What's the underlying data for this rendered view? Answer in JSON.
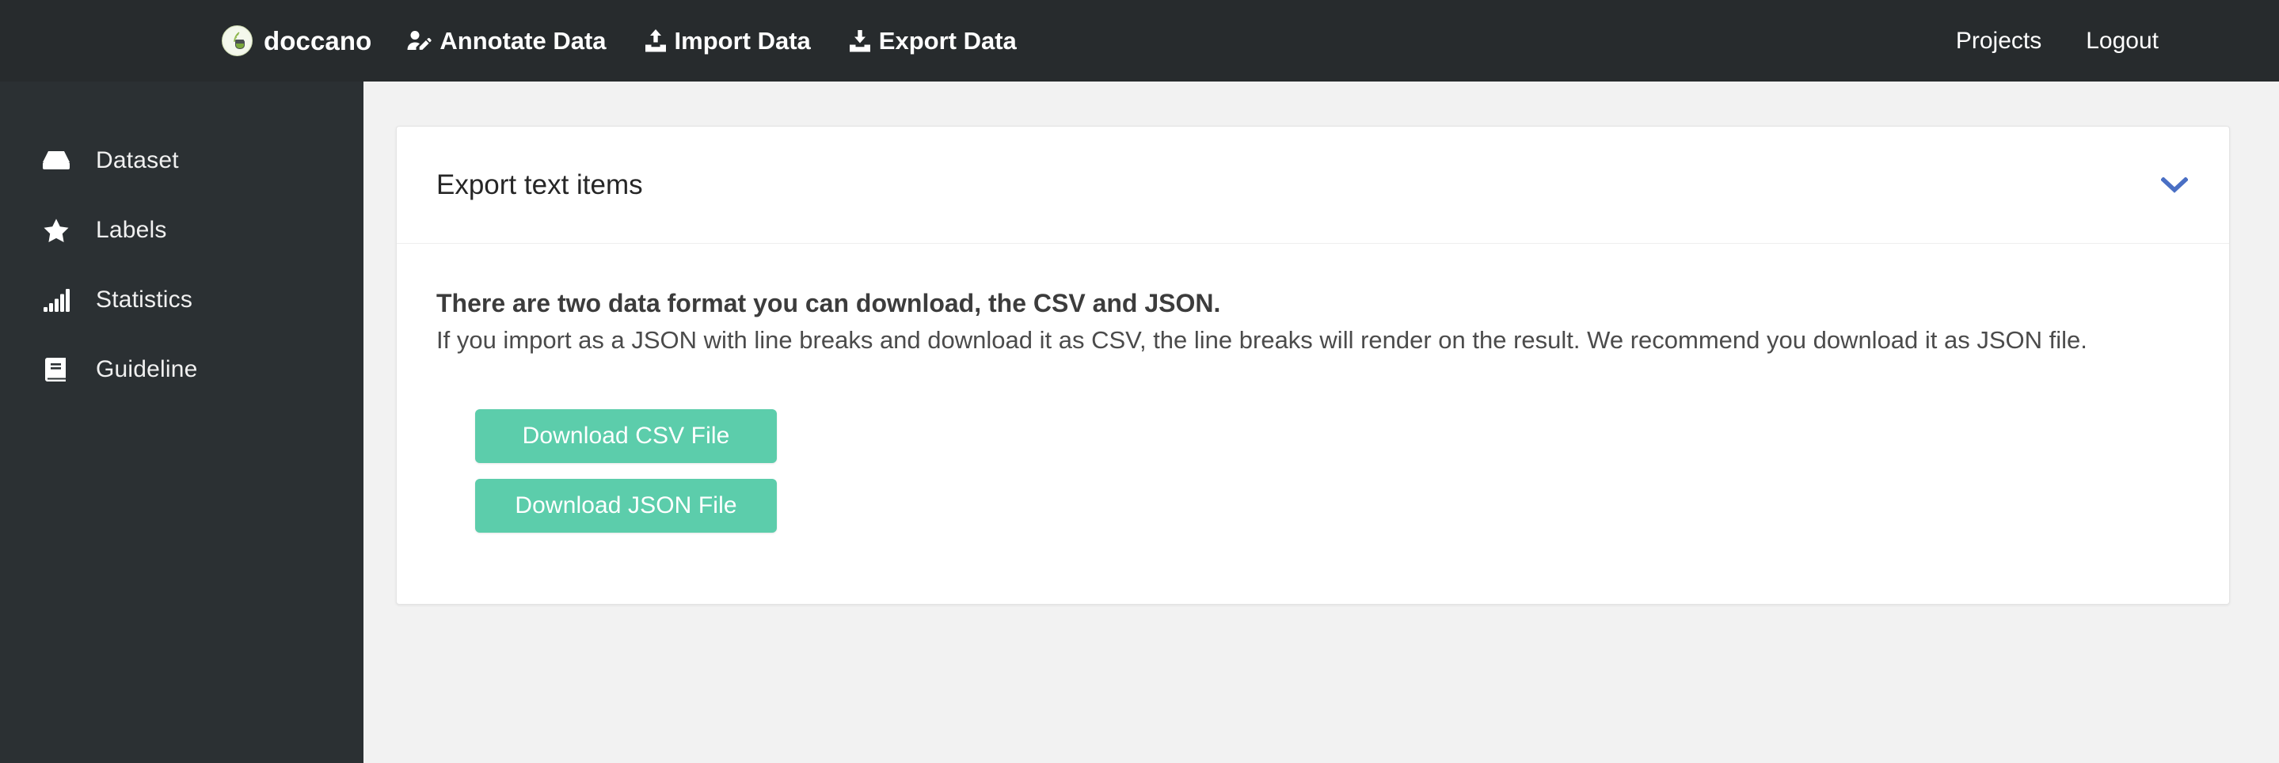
{
  "navbar": {
    "brand": {
      "label": "doccano",
      "icon": "doccano-logo-icon"
    },
    "items": [
      {
        "label": "Annotate Data",
        "icon": "user-edit-icon"
      },
      {
        "label": "Import Data",
        "icon": "upload-icon"
      },
      {
        "label": "Export Data",
        "icon": "download-icon"
      }
    ],
    "right_links": [
      {
        "label": "Projects"
      },
      {
        "label": "Logout"
      }
    ]
  },
  "sidebar": {
    "items": [
      {
        "label": "Dataset",
        "icon": "inbox-icon"
      },
      {
        "label": "Labels",
        "icon": "star-icon"
      },
      {
        "label": "Statistics",
        "icon": "bar-chart-icon"
      },
      {
        "label": "Guideline",
        "icon": "book-icon"
      }
    ]
  },
  "card": {
    "title": "Export text items",
    "collapse_icon": "chevron-down-icon",
    "lead": "There are two data format you can download, the CSV and JSON.",
    "sub": "If you import as a JSON with line breaks and download it as CSV, the line breaks will render on the result. We recommend you download it as JSON file.",
    "buttons": [
      {
        "label": "Download CSV File"
      },
      {
        "label": "Download JSON File"
      }
    ]
  },
  "colors": {
    "navbar_bg": "#272b2d",
    "sidebar_bg": "#2b3033",
    "page_bg": "#f2f2f2",
    "card_bg": "#ffffff",
    "button_green": "#5ccdab",
    "chevron_blue": "#4a6fc4"
  }
}
